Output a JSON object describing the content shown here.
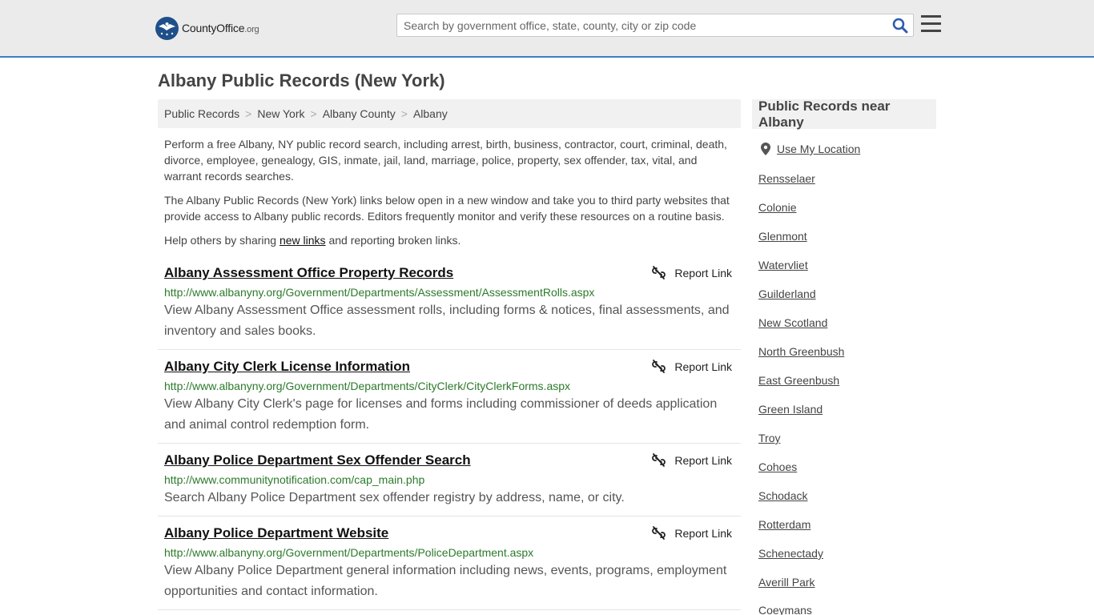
{
  "header": {
    "logo_county": "County",
    "logo_office": "Office",
    "logo_org": ".org",
    "search_placeholder": "Search by government office, state, county, city or zip code"
  },
  "page_title": "Albany Public Records (New York)",
  "breadcrumb": [
    "Public Records",
    "New York",
    "Albany County",
    "Albany"
  ],
  "breadcrumb_sep": ">",
  "intro": {
    "p1": "Perform a free Albany, NY public record search, including arrest, birth, business, contractor, court, criminal, death, divorce, employee, genealogy, GIS, inmate, jail, land, marriage, police, property, sex offender, tax, vital, and warrant records searches.",
    "p2": "The Albany Public Records (New York) links below open in a new window and take you to third party websites that provide access to Albany public records. Editors frequently monitor and verify these resources on a routine basis.",
    "p3_before": "Help others by sharing ",
    "p3_link": "new links",
    "p3_after": " and reporting broken links."
  },
  "report_label": "Report Link",
  "records": [
    {
      "title": "Albany Assessment Office Property Records",
      "url": "http://www.albanyny.org/Government/Departments/Assessment/AssessmentRolls.aspx",
      "desc": "View Albany Assessment Office assessment rolls, including forms & notices, final assessments, and inventory and sales books."
    },
    {
      "title": "Albany City Clerk License Information",
      "url": "http://www.albanyny.org/Government/Departments/CityClerk/CityClerkForms.aspx",
      "desc": "View Albany City Clerk's page for licenses and forms including commissioner of deeds application and animal control redemption form."
    },
    {
      "title": "Albany Police Department Sex Offender Search",
      "url": "http://www.communitynotification.com/cap_main.php",
      "desc": "Search Albany Police Department sex offender registry by address, name, or city."
    },
    {
      "title": "Albany Police Department Website",
      "url": "http://www.albanyny.org/Government/Departments/PoliceDepartment.aspx",
      "desc": "View Albany Police Department general information including news, events, programs, employment opportunities and contact information."
    }
  ],
  "sidebar": {
    "title": "Public Records near Albany",
    "use_location": "Use My Location",
    "places": [
      "Rensselaer",
      "Colonie",
      "Glenmont",
      "Watervliet",
      "Guilderland",
      "New Scotland",
      "North Greenbush",
      "East Greenbush",
      "Green Island",
      "Troy",
      "Cohoes",
      "Schodack",
      "Rotterdam",
      "Schenectady",
      "Averill Park",
      "Coeymans"
    ]
  }
}
